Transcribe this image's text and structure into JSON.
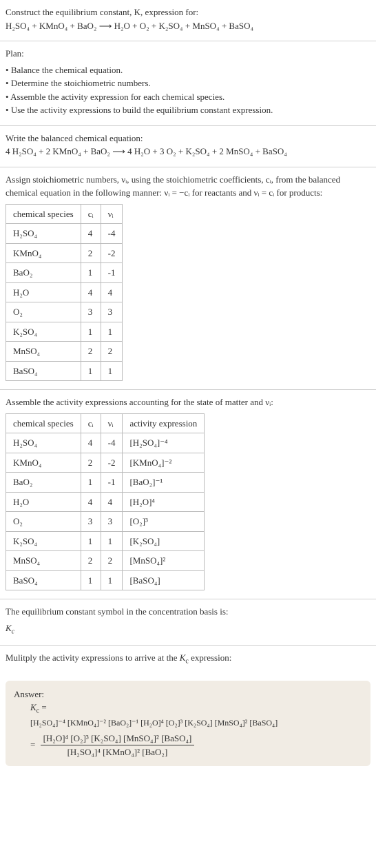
{
  "intro": {
    "line1": "Construct the equilibrium constant, K, expression for:",
    "eq": "H₂SO₄ + KMnO₄ + BaO₂ ⟶ H₂O + O₂ + K₂SO₄ + MnSO₄ + BaSO₄"
  },
  "plan": {
    "header": "Plan:",
    "items": [
      "Balance the chemical equation.",
      "Determine the stoichiometric numbers.",
      "Assemble the activity expression for each chemical species.",
      "Use the activity expressions to build the equilibrium constant expression."
    ]
  },
  "balanced": {
    "header": "Write the balanced chemical equation:",
    "eq": "4 H₂SO₄ + 2 KMnO₄ + BaO₂ ⟶ 4 H₂O + 3 O₂ + K₂SO₄ + 2 MnSO₄ + BaSO₄"
  },
  "assign": {
    "text": "Assign stoichiometric numbers, νᵢ, using the stoichiometric coefficients, cᵢ, from the balanced chemical equation in the following manner: νᵢ = −cᵢ for reactants and νᵢ = cᵢ for products:",
    "headers": [
      "chemical species",
      "cᵢ",
      "νᵢ"
    ],
    "rows": [
      {
        "sp": "H₂SO₄",
        "c": "4",
        "v": "-4"
      },
      {
        "sp": "KMnO₄",
        "c": "2",
        "v": "-2"
      },
      {
        "sp": "BaO₂",
        "c": "1",
        "v": "-1"
      },
      {
        "sp": "H₂O",
        "c": "4",
        "v": "4"
      },
      {
        "sp": "O₂",
        "c": "3",
        "v": "3"
      },
      {
        "sp": "K₂SO₄",
        "c": "1",
        "v": "1"
      },
      {
        "sp": "MnSO₄",
        "c": "2",
        "v": "2"
      },
      {
        "sp": "BaSO₄",
        "c": "1",
        "v": "1"
      }
    ]
  },
  "activity": {
    "text": "Assemble the activity expressions accounting for the state of matter and νᵢ:",
    "headers": [
      "chemical species",
      "cᵢ",
      "νᵢ",
      "activity expression"
    ],
    "rows": [
      {
        "sp": "H₂SO₄",
        "c": "4",
        "v": "-4",
        "a": "[H₂SO₄]⁻⁴"
      },
      {
        "sp": "KMnO₄",
        "c": "2",
        "v": "-2",
        "a": "[KMnO₄]⁻²"
      },
      {
        "sp": "BaO₂",
        "c": "1",
        "v": "-1",
        "a": "[BaO₂]⁻¹"
      },
      {
        "sp": "H₂O",
        "c": "4",
        "v": "4",
        "a": "[H₂O]⁴"
      },
      {
        "sp": "O₂",
        "c": "3",
        "v": "3",
        "a": "[O₂]³"
      },
      {
        "sp": "K₂SO₄",
        "c": "1",
        "v": "1",
        "a": "[K₂SO₄]"
      },
      {
        "sp": "MnSO₄",
        "c": "2",
        "v": "2",
        "a": "[MnSO₄]²"
      },
      {
        "sp": "BaSO₄",
        "c": "1",
        "v": "1",
        "a": "[BaSO₄]"
      }
    ]
  },
  "eqconst": {
    "line1": "The equilibrium constant symbol in the concentration basis is:",
    "symbol": "K_c"
  },
  "multiply": {
    "text": "Mulitply the activity expressions to arrive at the K_c expression:"
  },
  "answer": {
    "label": "Answer:",
    "kc_eq": "K_c =",
    "product": "[H₂SO₄]⁻⁴ [KMnO₄]⁻² [BaO₂]⁻¹ [H₂O]⁴ [O₂]³ [K₂SO₄] [MnSO₄]² [BaSO₄]",
    "eq2": "=",
    "num": "[H₂O]⁴ [O₂]³ [K₂SO₄] [MnSO₄]² [BaSO₄]",
    "den": "[H₂SO₄]⁴ [KMnO₄]² [BaO₂]"
  }
}
